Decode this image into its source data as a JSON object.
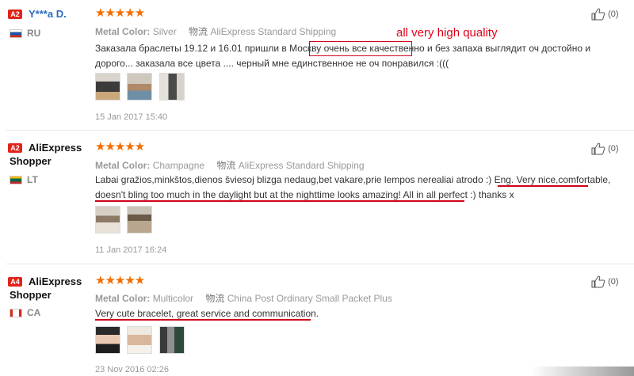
{
  "reviews": [
    {
      "badge": "A2",
      "badge_color": "#e2231a",
      "user": "Y***a D.",
      "country_code": "RU",
      "stars": "★★★★★",
      "metal_key": "Metal Color:",
      "metal_val": "Silver",
      "ship_key": "物流",
      "ship_val": "AliExpress Standard Shipping",
      "text": "Заказала браслеты 19.12 и 16.01 пришли в Москву очень все качественно и без запаха выглядит оч достойно и дорого... заказала все цвета .... черный мне единственное не оч понравился :(((",
      "date": "15 Jan 2017 15:40",
      "likes": "(0)"
    },
    {
      "badge": "A2",
      "badge_color": "#e2231a",
      "user": "AliExpress Shopper",
      "country_code": "LT",
      "stars": "★★★★★",
      "metal_key": "Metal Color:",
      "metal_val": "Champagne",
      "ship_key": "物流",
      "ship_val": "AliExpress Standard Shipping",
      "text": "Labai gražios,minkštos,dienos šviesoj blizga nedaug,bet vakare,prie lempos nerealiai atrodo :) Eng. Very nice,comfortable, doesn't bling too much in the daylight but at the nighttime looks amazing! All in all perfect :) thanks x",
      "date": "11 Jan 2017 16:24",
      "likes": "(0)"
    },
    {
      "badge": "A4",
      "badge_color": "#e2231a",
      "user": "AliExpress Shopper",
      "country_code": "CA",
      "stars": "★★★★★",
      "metal_key": "Metal Color:",
      "metal_val": "Multicolor",
      "ship_key": "物流",
      "ship_val": "China Post Ordinary Small Packet Plus",
      "text": "Very cute bracelet, great service and communication.",
      "date": "23 Nov 2016 02:26",
      "likes": "(0)"
    }
  ],
  "annotation": "all very high quality",
  "colors": {
    "accent": "#f36d00",
    "underline": "#d0021b",
    "annotation": "#e0001a"
  }
}
